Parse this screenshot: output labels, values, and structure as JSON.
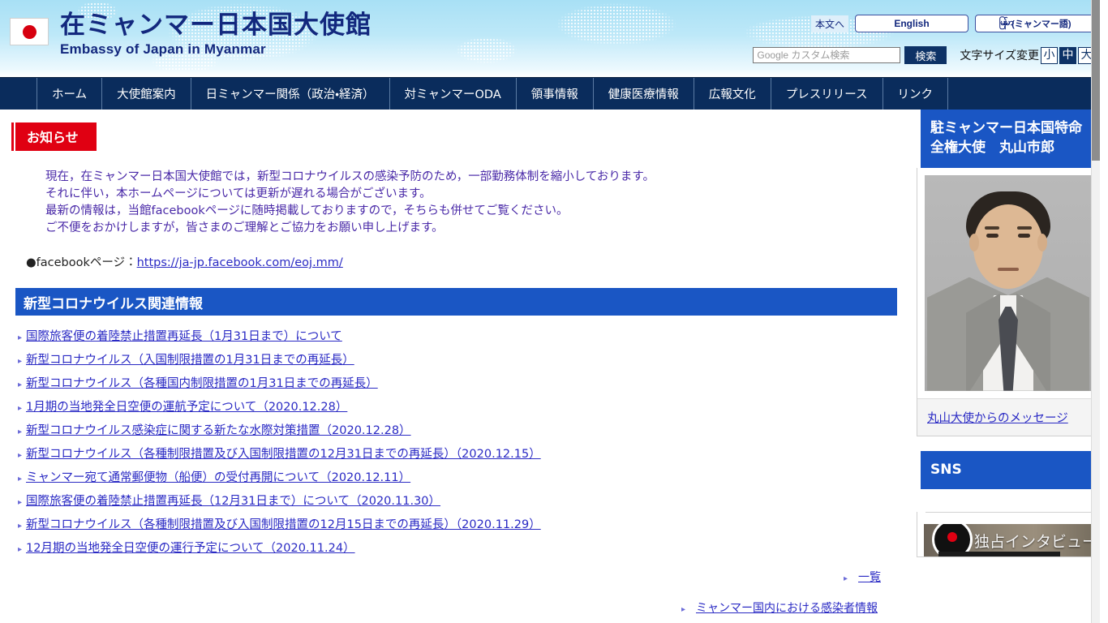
{
  "header": {
    "title_ja": "在ミャンマー日本国大使館",
    "title_en": "Embassy of Japan in Myanmar",
    "skip_link": "本文へ",
    "lang_english": "English",
    "lang_myanmar_script": "မြန်မာ",
    "lang_myanmar_suffix": "(ミャンマー語)",
    "search_placeholder": "Google カスタム検索",
    "search_value": "",
    "search_button": "検索",
    "fontsize_label": "文字サイズ変更",
    "fontsize_small": "小",
    "fontsize_medium": "中",
    "fontsize_large": "大",
    "fontsize_selected": "中"
  },
  "nav": {
    "items": [
      {
        "label": "ホーム"
      },
      {
        "label": "大使館案内"
      },
      {
        "label": "日ミャンマー関係（政治・経済）"
      },
      {
        "label": "対ミャンマーODA"
      },
      {
        "label": "領事情報"
      },
      {
        "label": "健康医療情報"
      },
      {
        "label": "広報文化"
      },
      {
        "label": "プレスリリース"
      },
      {
        "label": "リンク"
      }
    ]
  },
  "notice": {
    "badge": "お知らせ",
    "lines": [
      "現在，在ミャンマー日本国大使館では，新型コロナウイルスの感染予防のため，一部勤務体制を縮小しております。",
      "それに伴い，本ホームページについては更新が遅れる場合がございます。",
      "最新の情報は，当館facebookページに随時掲載しておりますので，そちらも併せてご覧ください。",
      "ご不便をおかけしますが，皆さまのご理解とご協力をお願い申し上げます。"
    ],
    "fb_label": "●facebookページ：",
    "fb_link": "https://ja-jp.facebook.com/eoj.mm/"
  },
  "covid_section": {
    "heading": "新型コロナウイルス関連情報",
    "links": [
      {
        "label": "国際旅客便の着陸禁止措置再延長（1月31日まで）について"
      },
      {
        "label": "新型コロナウイルス（入国制限措置の1月31日までの再延長）"
      },
      {
        "label": "新型コロナウイルス（各種国内制限措置の1月31日までの再延長）"
      },
      {
        "label": "1月期の当地発全日空便の運航予定について（2020.12.28）"
      },
      {
        "label": "新型コロナウイルス感染症に関する新たな水際対策措置（2020.12.28）"
      },
      {
        "label": "新型コロナウイルス（各種制限措置及び入国制限措置の12月31日までの再延長）（2020.12.15）"
      },
      {
        "label": "ミャンマー宛て通常郵便物（船便）の受付再開について（2020.12.11）"
      },
      {
        "label": "国際旅客便の着陸禁止措置再延長（12月31日まで）について（2020.11.30）"
      },
      {
        "label": "新型コロナウイルス（各種制限措置及び入国制限措置の12月15日までの再延長）（2020.11.29）"
      },
      {
        "label": "12月期の当地発全日空便の運行予定について（2020.11.24）"
      }
    ],
    "more_label": "一覧",
    "next_label": "ミャンマー国内における感染者情報"
  },
  "sidebar": {
    "ambassador": {
      "heading": "駐ミャンマー日本国特命全権大使　丸山市郎",
      "photo_alt": "丸山市郎大使",
      "message_link": "丸山大使からのメッセージ"
    },
    "sns": {
      "heading": "SNS",
      "video_title": "独占インタビュー『"
    }
  },
  "colors": {
    "nav_blue": "#0a2c5c",
    "section_blue": "#1a56c4",
    "notice_red": "#e00012",
    "brand_navy": "#13287e",
    "link_blue": "#2a2ac4",
    "notice_text_purple": "#4a2aa8"
  }
}
